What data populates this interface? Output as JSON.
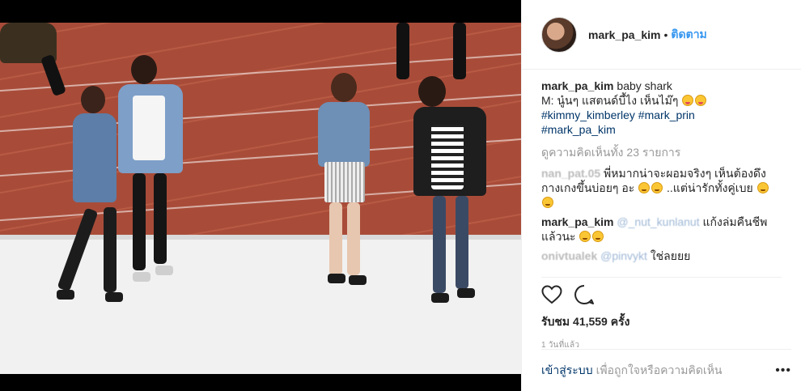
{
  "post": {
    "username": "mark_pa_kim",
    "separator": "•",
    "follow_label": "ติดตาม"
  },
  "caption": {
    "username": "mark_pa_kim",
    "text_line1": "baby shark",
    "text_line2": "M: นู๋นๆ แสตนด์บี้ไง เห็นไม๊ๆ",
    "hashtags_line1": "#kimmy_kimberley #mark_prin",
    "hashtags_line2": "#mark_pa_kim"
  },
  "view_all_comments": "ดูความคิดเห็นทั้ง 23 รายการ",
  "comments": [
    {
      "username": "nan_pat.05",
      "text_line1": "พี่หมากน่าจะผอมจริงๆ เห็นต้องดึง",
      "text_line2": "กางเกงขึ้นบ่อยๆ อะ",
      "text_line2b": "..แต่น่ารักทั้งคู่เบย"
    },
    {
      "username": "mark_pa_kim",
      "mention": "@_nut_kunlanut",
      "text_line1": "แก้งล่มคืนชีพ",
      "text_line2": "แล้วนะ"
    },
    {
      "username": "onivtualek",
      "mention": "@pinvykt",
      "text": "ใช่ลยยย"
    }
  ],
  "likes": "รับชม 41,559 ครั้ง",
  "time_ago": "1 วันที่แล้ว",
  "footer": {
    "login_label": "เข้าสู่ระบบ",
    "login_text": "เพื่อถูกใจหรือความคิดเห็น",
    "more_label": "•••"
  },
  "icons": {
    "like": "heart-icon",
    "comment": "comment-icon",
    "more": "more-options-icon"
  },
  "colors": {
    "link_blue": "#3897f0",
    "hashtag": "#003569",
    "muted": "#999999"
  }
}
